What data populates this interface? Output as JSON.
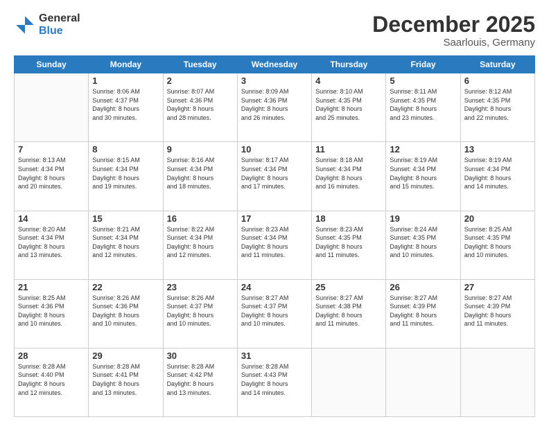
{
  "logo": {
    "general": "General",
    "blue": "Blue"
  },
  "header": {
    "month": "December 2025",
    "location": "Saarlouis, Germany"
  },
  "weekdays": [
    "Sunday",
    "Monday",
    "Tuesday",
    "Wednesday",
    "Thursday",
    "Friday",
    "Saturday"
  ],
  "weeks": [
    [
      {
        "day": "",
        "sunrise": "",
        "sunset": "",
        "daylight": ""
      },
      {
        "day": "1",
        "sunrise": "Sunrise: 8:06 AM",
        "sunset": "Sunset: 4:37 PM",
        "daylight": "Daylight: 8 hours and 30 minutes."
      },
      {
        "day": "2",
        "sunrise": "Sunrise: 8:07 AM",
        "sunset": "Sunset: 4:36 PM",
        "daylight": "Daylight: 8 hours and 28 minutes."
      },
      {
        "day": "3",
        "sunrise": "Sunrise: 8:09 AM",
        "sunset": "Sunset: 4:36 PM",
        "daylight": "Daylight: 8 hours and 26 minutes."
      },
      {
        "day": "4",
        "sunrise": "Sunrise: 8:10 AM",
        "sunset": "Sunset: 4:35 PM",
        "daylight": "Daylight: 8 hours and 25 minutes."
      },
      {
        "day": "5",
        "sunrise": "Sunrise: 8:11 AM",
        "sunset": "Sunset: 4:35 PM",
        "daylight": "Daylight: 8 hours and 23 minutes."
      },
      {
        "day": "6",
        "sunrise": "Sunrise: 8:12 AM",
        "sunset": "Sunset: 4:35 PM",
        "daylight": "Daylight: 8 hours and 22 minutes."
      }
    ],
    [
      {
        "day": "7",
        "sunrise": "Sunrise: 8:13 AM",
        "sunset": "Sunset: 4:34 PM",
        "daylight": "Daylight: 8 hours and 20 minutes."
      },
      {
        "day": "8",
        "sunrise": "Sunrise: 8:15 AM",
        "sunset": "Sunset: 4:34 PM",
        "daylight": "Daylight: 8 hours and 19 minutes."
      },
      {
        "day": "9",
        "sunrise": "Sunrise: 8:16 AM",
        "sunset": "Sunset: 4:34 PM",
        "daylight": "Daylight: 8 hours and 18 minutes."
      },
      {
        "day": "10",
        "sunrise": "Sunrise: 8:17 AM",
        "sunset": "Sunset: 4:34 PM",
        "daylight": "Daylight: 8 hours and 17 minutes."
      },
      {
        "day": "11",
        "sunrise": "Sunrise: 8:18 AM",
        "sunset": "Sunset: 4:34 PM",
        "daylight": "Daylight: 8 hours and 16 minutes."
      },
      {
        "day": "12",
        "sunrise": "Sunrise: 8:19 AM",
        "sunset": "Sunset: 4:34 PM",
        "daylight": "Daylight: 8 hours and 15 minutes."
      },
      {
        "day": "13",
        "sunrise": "Sunrise: 8:19 AM",
        "sunset": "Sunset: 4:34 PM",
        "daylight": "Daylight: 8 hours and 14 minutes."
      }
    ],
    [
      {
        "day": "14",
        "sunrise": "Sunrise: 8:20 AM",
        "sunset": "Sunset: 4:34 PM",
        "daylight": "Daylight: 8 hours and 13 minutes."
      },
      {
        "day": "15",
        "sunrise": "Sunrise: 8:21 AM",
        "sunset": "Sunset: 4:34 PM",
        "daylight": "Daylight: 8 hours and 12 minutes."
      },
      {
        "day": "16",
        "sunrise": "Sunrise: 8:22 AM",
        "sunset": "Sunset: 4:34 PM",
        "daylight": "Daylight: 8 hours and 12 minutes."
      },
      {
        "day": "17",
        "sunrise": "Sunrise: 8:23 AM",
        "sunset": "Sunset: 4:34 PM",
        "daylight": "Daylight: 8 hours and 11 minutes."
      },
      {
        "day": "18",
        "sunrise": "Sunrise: 8:23 AM",
        "sunset": "Sunset: 4:35 PM",
        "daylight": "Daylight: 8 hours and 11 minutes."
      },
      {
        "day": "19",
        "sunrise": "Sunrise: 8:24 AM",
        "sunset": "Sunset: 4:35 PM",
        "daylight": "Daylight: 8 hours and 10 minutes."
      },
      {
        "day": "20",
        "sunrise": "Sunrise: 8:25 AM",
        "sunset": "Sunset: 4:35 PM",
        "daylight": "Daylight: 8 hours and 10 minutes."
      }
    ],
    [
      {
        "day": "21",
        "sunrise": "Sunrise: 8:25 AM",
        "sunset": "Sunset: 4:36 PM",
        "daylight": "Daylight: 8 hours and 10 minutes."
      },
      {
        "day": "22",
        "sunrise": "Sunrise: 8:26 AM",
        "sunset": "Sunset: 4:36 PM",
        "daylight": "Daylight: 8 hours and 10 minutes."
      },
      {
        "day": "23",
        "sunrise": "Sunrise: 8:26 AM",
        "sunset": "Sunset: 4:37 PM",
        "daylight": "Daylight: 8 hours and 10 minutes."
      },
      {
        "day": "24",
        "sunrise": "Sunrise: 8:27 AM",
        "sunset": "Sunset: 4:37 PM",
        "daylight": "Daylight: 8 hours and 10 minutes."
      },
      {
        "day": "25",
        "sunrise": "Sunrise: 8:27 AM",
        "sunset": "Sunset: 4:38 PM",
        "daylight": "Daylight: 8 hours and 11 minutes."
      },
      {
        "day": "26",
        "sunrise": "Sunrise: 8:27 AM",
        "sunset": "Sunset: 4:39 PM",
        "daylight": "Daylight: 8 hours and 11 minutes."
      },
      {
        "day": "27",
        "sunrise": "Sunrise: 8:27 AM",
        "sunset": "Sunset: 4:39 PM",
        "daylight": "Daylight: 8 hours and 11 minutes."
      }
    ],
    [
      {
        "day": "28",
        "sunrise": "Sunrise: 8:28 AM",
        "sunset": "Sunset: 4:40 PM",
        "daylight": "Daylight: 8 hours and 12 minutes."
      },
      {
        "day": "29",
        "sunrise": "Sunrise: 8:28 AM",
        "sunset": "Sunset: 4:41 PM",
        "daylight": "Daylight: 8 hours and 13 minutes."
      },
      {
        "day": "30",
        "sunrise": "Sunrise: 8:28 AM",
        "sunset": "Sunset: 4:42 PM",
        "daylight": "Daylight: 8 hours and 13 minutes."
      },
      {
        "day": "31",
        "sunrise": "Sunrise: 8:28 AM",
        "sunset": "Sunset: 4:43 PM",
        "daylight": "Daylight: 8 hours and 14 minutes."
      },
      {
        "day": "",
        "sunrise": "",
        "sunset": "",
        "daylight": ""
      },
      {
        "day": "",
        "sunrise": "",
        "sunset": "",
        "daylight": ""
      },
      {
        "day": "",
        "sunrise": "",
        "sunset": "",
        "daylight": ""
      }
    ]
  ]
}
